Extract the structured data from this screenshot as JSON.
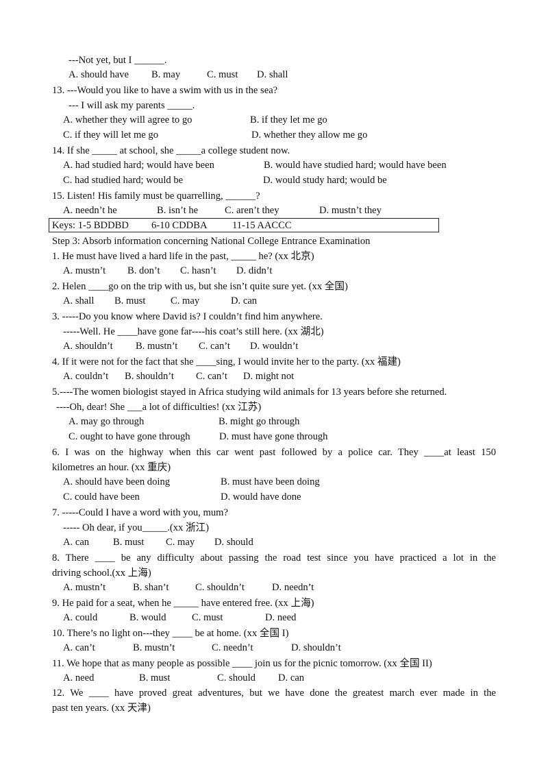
{
  "part_top": {
    "q12_tail": {
      "line": "---Not yet, but I ______.",
      "options": [
        "A. should have",
        "B. may",
        "C. must",
        "D. shall"
      ]
    },
    "q13": {
      "line1": "13. ---Would you like to have a swim with us in the sea?",
      "line2": "--- I will ask my parents _____.",
      "options": [
        "A. whether they will agree to go",
        "B. if they let me go",
        "C. if they will let me go",
        "D. whether they allow me go"
      ]
    },
    "q14": {
      "line": "14. If she _____ at school, she _____a college student now.",
      "options": [
        "A. had studied hard; would have been",
        "B. would have studied hard; would have been",
        "C. had studied hard; would be",
        "D. would study hard; would be"
      ]
    },
    "q15": {
      "line": "15. Listen! His family must be quarrelling, ______?",
      "options": [
        "A. needn’t he",
        "B. isn’t he",
        "C. aren’t they",
        "D. mustn’t they"
      ]
    },
    "keys": {
      "label": "Keys: 1-5 BDDBD",
      "k2": "6-10 CDDBA",
      "k3": "11-15 AACCC"
    }
  },
  "step3": {
    "heading": "Step 3: Absorb information concerning National College Entrance Examination",
    "questions": [
      {
        "lines": [
          "1. He must have lived a hard life in the past, _____ he? (xx 北京)"
        ],
        "options": [
          "A. mustn’t",
          "B. don’t",
          "C. hasn’t",
          "D. didn’t"
        ]
      },
      {
        "lines": [
          "2. Helen ____go on the trip with us, but she isn’t quite sure yet. (xx 全国)"
        ],
        "options": [
          "A. shall",
          "B. must",
          "C. may",
          "D. can"
        ]
      },
      {
        "lines": [
          "3. -----Do you know where David is? I couldn’t find him anywhere.",
          "-----Well. He ____have gone far----his coat’s still here. (xx 湖北)"
        ],
        "options": [
          "A. shouldn’t",
          "B. mustn’t",
          "C. can’t",
          "D. wouldn’t"
        ]
      },
      {
        "lines": [
          "4. If it were not for the fact that she ____sing, I would invite her to the party. (xx 福建)"
        ],
        "options": [
          "A. couldn’t",
          "B. shouldn’t",
          "C. can’t",
          "D. might not"
        ]
      },
      {
        "lines": [
          "5.----The women biologist stayed in Africa studying wild animals for 13 years before she returned.",
          "----Oh, dear! She ___a lot of difficulties! (xx 江苏)"
        ],
        "options": [
          "A. may go through",
          "B. might go through",
          "C. ought to have gone through",
          "D. must have gone through"
        ]
      },
      {
        "lines": [
          "6. I was on the highway when this car went past followed by a police car. They ____at least 150",
          "kilometres an hour. (xx 重庆)"
        ],
        "options": [
          "A. should have been doing",
          "B. must have been doing",
          "C. could have been",
          "D. would have done"
        ]
      },
      {
        "lines": [
          "7. -----Could I have a word with you, mum?",
          "----- Oh dear, if you_____.(xx 浙江)"
        ],
        "options": [
          "A. can",
          "B. must",
          "C. may",
          "D. should"
        ]
      },
      {
        "lines": [
          "8. There ____ be any difficulty about passing the road test since you have practiced a lot in the",
          "driving school.(xx 上海)"
        ],
        "options": [
          "A. mustn’t",
          "B. shan’t",
          "C. shouldn’t",
          "D. needn’t"
        ]
      },
      {
        "lines": [
          "9. He paid for a seat, when he _____ have entered free. (xx 上海)"
        ],
        "options": [
          "A. could",
          "B. would",
          "C. must",
          "D. need"
        ]
      },
      {
        "lines": [
          "10. There’s no light on---they ____ be at home. (xx 全国 I)"
        ],
        "options": [
          "A. can’t",
          "B. mustn’t",
          "C. needn’t",
          "D. shouldn’t"
        ]
      },
      {
        "lines": [
          "11. We hope that as many people as possible ____ join us for the picnic tomorrow. (xx 全国 II)"
        ],
        "options": [
          "A. need",
          "B. must",
          "C. should",
          "D. can"
        ]
      },
      {
        "lines": [
          "12. We ____ have proved great adventures, but we have done the greatest march ever made in the",
          "past ten years. (xx 天津)"
        ]
      }
    ]
  }
}
